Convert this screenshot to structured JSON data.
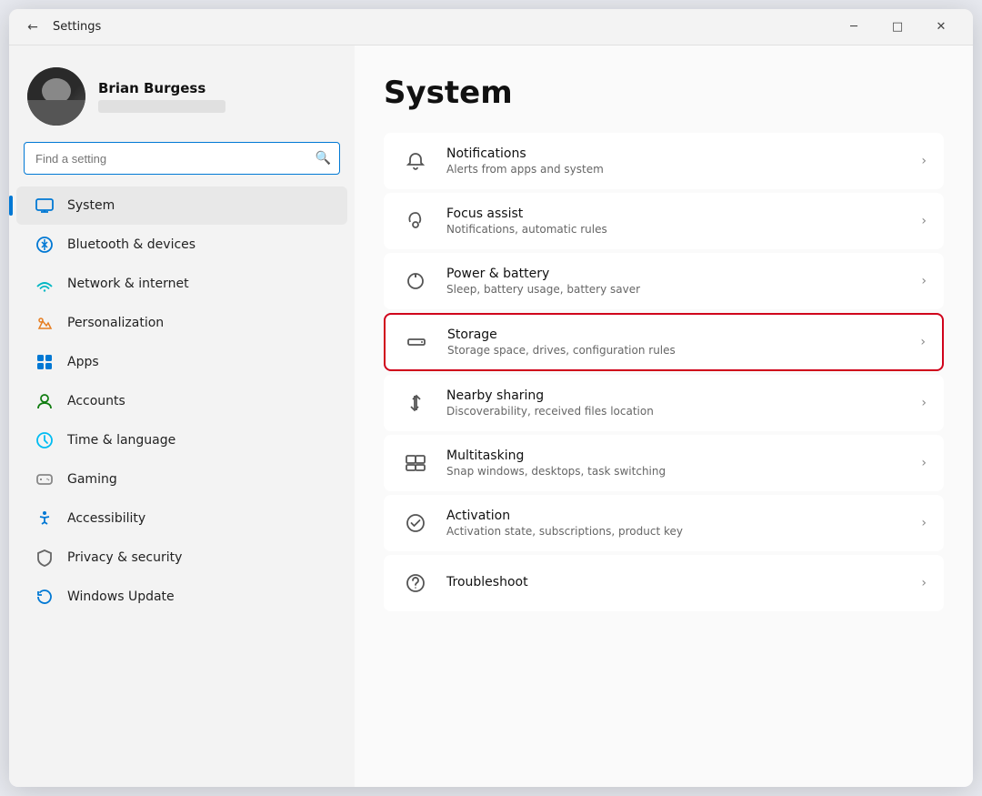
{
  "window": {
    "title": "Settings",
    "controls": {
      "minimize": "─",
      "maximize": "□",
      "close": "✕"
    }
  },
  "user": {
    "name": "Brian Burgess",
    "email_placeholder": ""
  },
  "search": {
    "placeholder": "Find a setting"
  },
  "nav": {
    "items": [
      {
        "id": "system",
        "label": "System",
        "icon": "🖥",
        "iconClass": "blue",
        "active": true
      },
      {
        "id": "bluetooth",
        "label": "Bluetooth & devices",
        "icon": "⬡",
        "iconClass": "blue",
        "active": false
      },
      {
        "id": "network",
        "label": "Network & internet",
        "icon": "◈",
        "iconClass": "teal",
        "active": false
      },
      {
        "id": "personalization",
        "label": "Personalization",
        "icon": "✏",
        "iconClass": "orange",
        "active": false
      },
      {
        "id": "apps",
        "label": "Apps",
        "icon": "⊞",
        "iconClass": "blue",
        "active": false
      },
      {
        "id": "accounts",
        "label": "Accounts",
        "icon": "●",
        "iconClass": "green",
        "active": false
      },
      {
        "id": "time",
        "label": "Time & language",
        "icon": "⊕",
        "iconClass": "lightblue",
        "active": false
      },
      {
        "id": "gaming",
        "label": "Gaming",
        "icon": "⊕",
        "iconClass": "gray",
        "active": false
      },
      {
        "id": "accessibility",
        "label": "Accessibility",
        "icon": "✦",
        "iconClass": "blue",
        "active": false
      },
      {
        "id": "privacy",
        "label": "Privacy & security",
        "icon": "⊛",
        "iconClass": "shield",
        "active": false
      },
      {
        "id": "windowsupdate",
        "label": "Windows Update",
        "icon": "↻",
        "iconClass": "refresh",
        "active": false
      }
    ]
  },
  "main": {
    "title": "System",
    "settings": [
      {
        "id": "notifications",
        "title": "Notifications",
        "desc": "Alerts from apps and system",
        "icon": "🔔",
        "highlighted": false
      },
      {
        "id": "focus",
        "title": "Focus assist",
        "desc": "Notifications, automatic rules",
        "icon": "☾",
        "highlighted": false
      },
      {
        "id": "power",
        "title": "Power & battery",
        "desc": "Sleep, battery usage, battery saver",
        "icon": "⏻",
        "highlighted": false
      },
      {
        "id": "storage",
        "title": "Storage",
        "desc": "Storage space, drives, configuration rules",
        "icon": "⊟",
        "highlighted": true
      },
      {
        "id": "nearby",
        "title": "Nearby sharing",
        "desc": "Discoverability, received files location",
        "icon": "⇄",
        "highlighted": false
      },
      {
        "id": "multitasking",
        "title": "Multitasking",
        "desc": "Snap windows, desktops, task switching",
        "icon": "⧉",
        "highlighted": false
      },
      {
        "id": "activation",
        "title": "Activation",
        "desc": "Activation state, subscriptions, product key",
        "icon": "✓",
        "highlighted": false
      },
      {
        "id": "troubleshoot",
        "title": "Troubleshoot",
        "desc": "",
        "icon": "⚙",
        "highlighted": false
      }
    ]
  }
}
